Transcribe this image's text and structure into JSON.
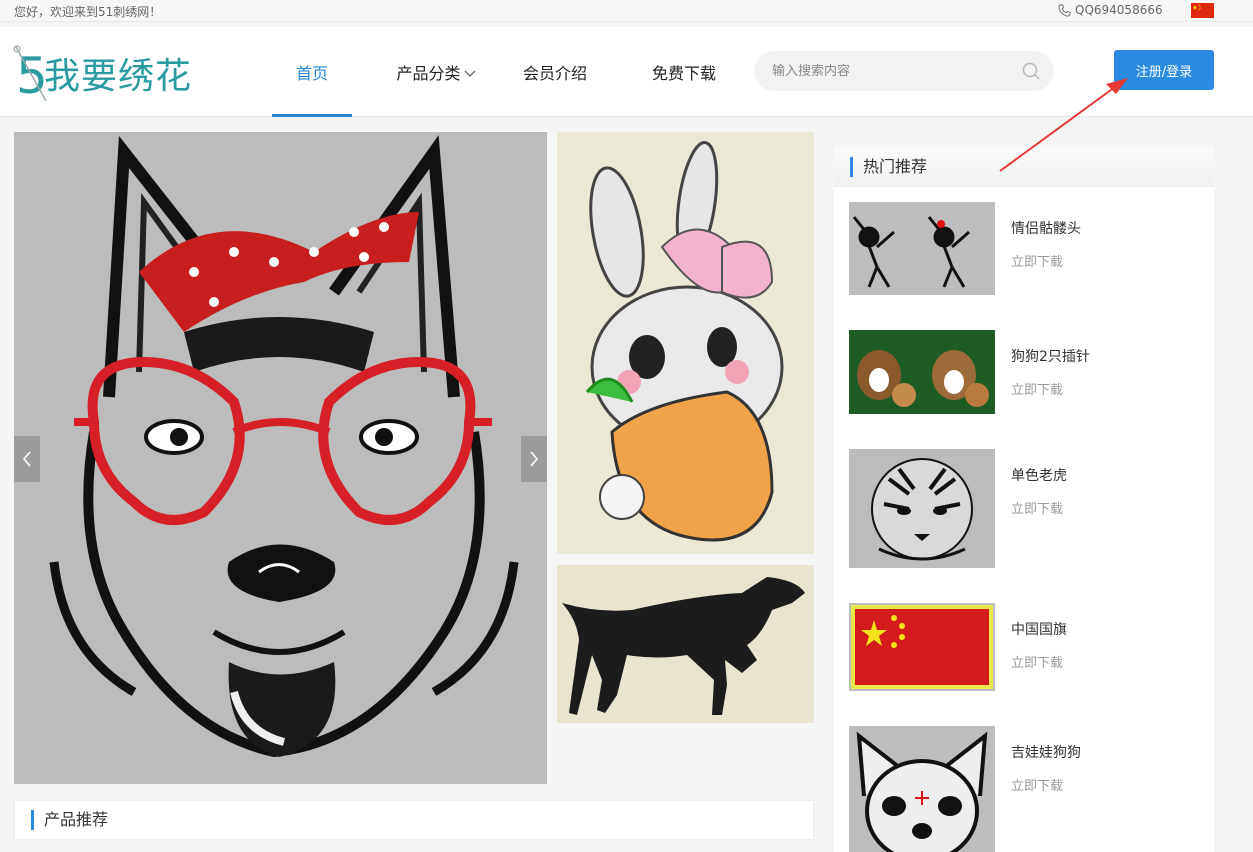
{
  "topbar": {
    "welcome": "您好，欢迎来到51刺绣网！",
    "qq": "QQ694058666"
  },
  "header": {
    "logo_text": "我要绣花",
    "nav": [
      {
        "label": "首页",
        "active": true
      },
      {
        "label": "产品分类",
        "has_dropdown": true
      },
      {
        "label": "会员介绍"
      },
      {
        "label": "免费下载"
      }
    ],
    "search_placeholder": "输入搜索内容",
    "login_label": "注册/登录"
  },
  "section": {
    "products_title": "产品推荐"
  },
  "hot": {
    "title": "热门推荐",
    "items": [
      {
        "name": "情侣骷髅头",
        "action": "立即下载"
      },
      {
        "name": "狗狗2只插针",
        "action": "立即下载"
      },
      {
        "name": "单色老虎",
        "action": "立即下载"
      },
      {
        "name": "中国国旗",
        "action": "立即下载"
      },
      {
        "name": "吉娃娃狗狗",
        "action": "立即下载"
      }
    ]
  },
  "colors": {
    "accent": "#2b8be0",
    "logo": "#2b9aa0",
    "annotation_arrow": "#e53935"
  }
}
